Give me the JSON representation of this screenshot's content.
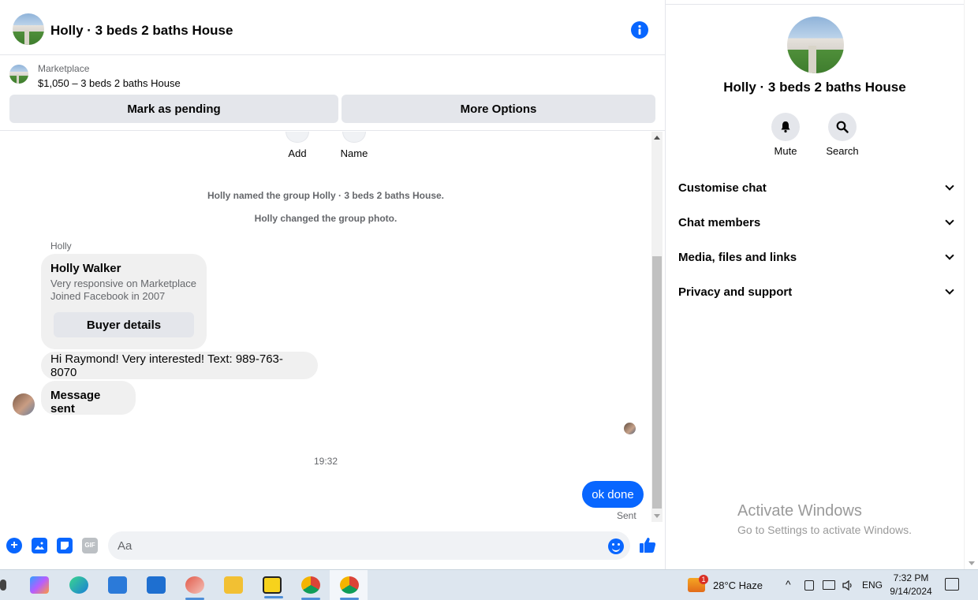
{
  "chat": {
    "title": "Holly · 3 beds 2 baths House",
    "marketplace_label": "Marketplace",
    "listing": "$1,050 – 3 beds 2 baths House",
    "mark_pending_label": "Mark as pending",
    "more_options_label": "More Options",
    "mini_actions": [
      {
        "label": "Add"
      },
      {
        "label": "Name"
      }
    ],
    "system_messages": [
      "Holly named the group Holly · 3 beds 2 baths House.",
      "Holly changed the group photo."
    ],
    "sender_label": "Holly",
    "profile_card": {
      "name": "Holly Walker",
      "line1": "Very responsive on Marketplace",
      "line2": "Joined Facebook in 2007",
      "button_label": "Buyer details"
    },
    "incoming": [
      "Hi Raymond! Very interested!  Text: 989-763-8070",
      "Message sent"
    ],
    "timestamp": "19:32",
    "outgoing": "ok done",
    "sent_status": "Sent",
    "composer": {
      "placeholder": "Aa",
      "gif_label": "GIF"
    }
  },
  "details": {
    "title": "Holly · 3 beds 2 baths House",
    "actions": [
      {
        "label": "Mute",
        "icon": "bell-icon"
      },
      {
        "label": "Search",
        "icon": "search-icon"
      }
    ],
    "sections": [
      "Customise chat",
      "Chat members",
      "Media, files and links",
      "Privacy and support"
    ]
  },
  "watermark": {
    "line1": "Activate Windows",
    "line2": "Go to Settings to activate Windows."
  },
  "taskbar": {
    "weather_badge": "1",
    "weather": "28°C  Haze",
    "language": "ENG",
    "time": "7:32 PM",
    "date": "9/14/2024"
  },
  "colors": {
    "accent": "#0866ff",
    "bubble_in": "#f0f0f0",
    "button_bg": "#e4e6eb"
  }
}
